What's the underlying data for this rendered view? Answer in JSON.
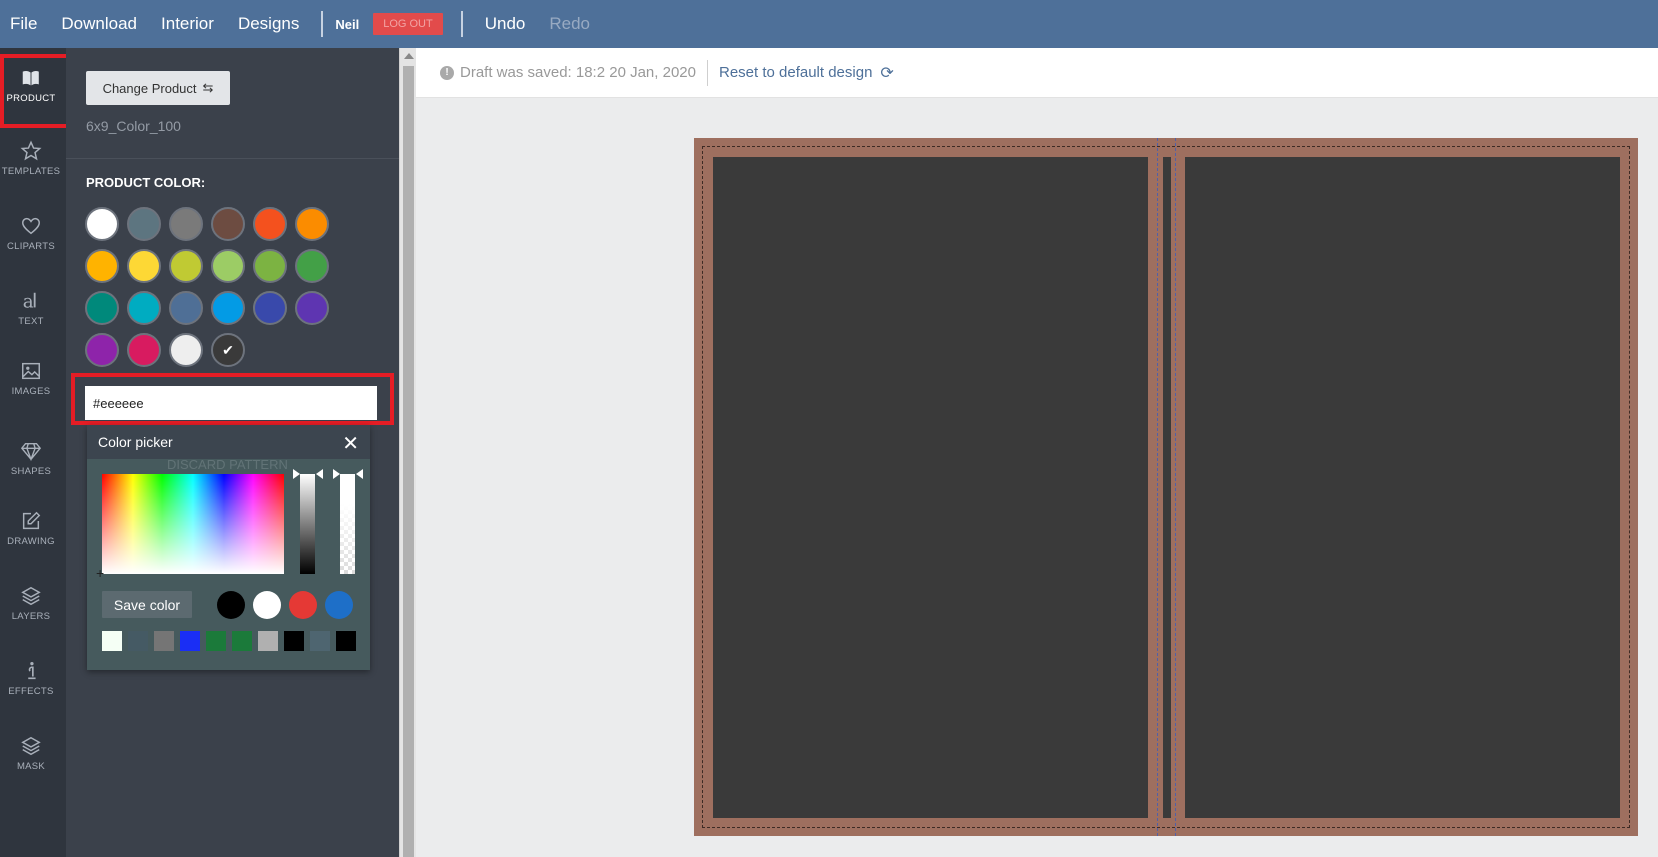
{
  "topbar": {
    "menu": [
      "File",
      "Download",
      "Interior",
      "Designs"
    ],
    "user": "Neil",
    "logout": "LOG OUT",
    "undo": "Undo",
    "redo": "Redo"
  },
  "sidebar": {
    "items": [
      {
        "label": "PRODUCT",
        "icon": "book-icon",
        "active": true
      },
      {
        "label": "TEMPLATES",
        "icon": "star-icon"
      },
      {
        "label": "CLIPARTS",
        "icon": "heart-icon"
      },
      {
        "label": "TEXT",
        "icon": "text-icon"
      },
      {
        "label": "IMAGES",
        "icon": "image-icon"
      },
      {
        "label": "SHAPES",
        "icon": "diamond-icon"
      },
      {
        "label": "DRAWING",
        "icon": "pencil-icon"
      },
      {
        "label": "LAYERS",
        "icon": "layers-icon"
      },
      {
        "label": "EFFECTS",
        "icon": "effects-icon"
      },
      {
        "label": "MASK",
        "icon": "mask-icon"
      }
    ]
  },
  "panel": {
    "change_product": "Change Product",
    "product_name": "6x9_Color_100",
    "product_color_label": "PRODUCT COLOR:",
    "swatches": [
      "#ffffff",
      "#5d7580",
      "#7a7a7a",
      "#6d4c41",
      "#f4511e",
      "#fb8c00",
      "#ffb300",
      "#fdd835",
      "#c0ca33",
      "#9ccc65",
      "#7cb342",
      "#43a047",
      "#00897b",
      "#00acc1",
      "#4f6f96",
      "#039be5",
      "#3949ab",
      "#5e35b1",
      "#8e24aa",
      "#d81b60",
      "#eeeeee",
      "#3a3a3a"
    ],
    "selected_swatch": 21,
    "hex_value": "#eeeeee"
  },
  "picker": {
    "title": "Color picker",
    "ghost_text": "DISCARD PATTERN",
    "save_color": "Save color",
    "saved_colors": [
      "#000000",
      "#ffffff",
      "#e53935",
      "#1e6fc8"
    ],
    "recent_colors": [
      "#f5fff5",
      "#455a64",
      "#757575",
      "#1a2ef5",
      "#1b7a3a",
      "#1b7a3a",
      "#b0b0b0",
      "#000000",
      "#4e6570",
      "#000000"
    ]
  },
  "canvas": {
    "draft_text": "Draft was saved: 18:2 20 Jan, 2020",
    "reset_text": "Reset to default design",
    "cover_color": "#9e6f5f",
    "face_color": "#3a3a3a"
  }
}
